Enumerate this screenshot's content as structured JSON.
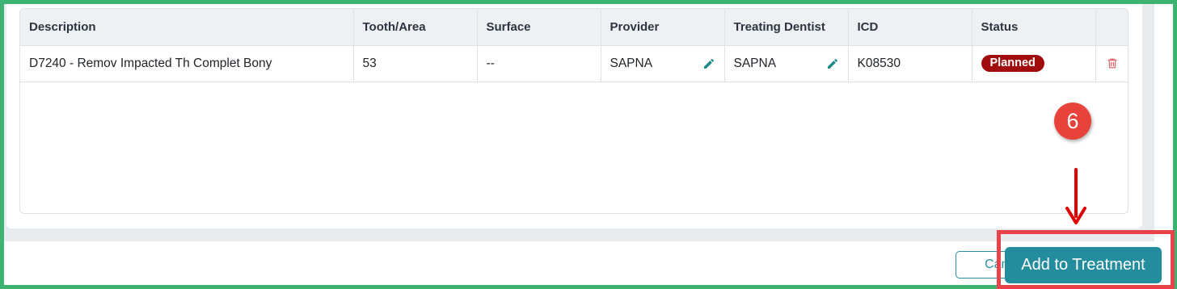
{
  "table": {
    "headers": [
      "Description",
      "Tooth/Area",
      "Surface",
      "Provider",
      "Treating Dentist",
      "ICD",
      "Status"
    ],
    "rows": [
      {
        "description": "D7240 - Remov Impacted Th Complet Bony",
        "tooth_area": "53",
        "surface": "--",
        "provider": "SAPNA",
        "treating_dentist": "SAPNA",
        "icd": "K08530",
        "status": "Planned"
      }
    ]
  },
  "annotation": {
    "step_number": "6"
  },
  "footer": {
    "cancel_label": "Cancel",
    "add_label": "Add to Treatment"
  },
  "colors": {
    "frame_green": "#3cb371",
    "highlight_red": "#e8434b",
    "status_planned": "#a10d0d",
    "primary_teal": "#238d9e"
  },
  "icons": [
    "pencil-icon",
    "trash-icon",
    "arrow-down-icon"
  ]
}
